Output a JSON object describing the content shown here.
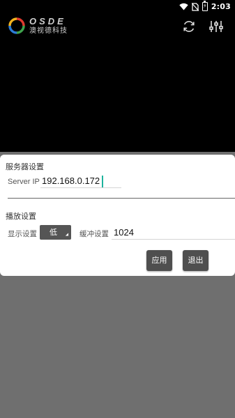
{
  "status_bar": {
    "time": "2:03",
    "icons": [
      "wifi-icon",
      "no-sim-icon",
      "battery-charging-icon"
    ]
  },
  "header": {
    "logo_brand": "OSDE",
    "logo_name": "澳视德科技",
    "logo_colors": [
      "#e03a2f",
      "#3fa34d",
      "#2b7bd6",
      "#f2b21e"
    ],
    "icons": [
      "refresh-icon",
      "tune-icon"
    ]
  },
  "dialog": {
    "server_section_title": "服务器设置",
    "server_ip_label": "Server IP",
    "server_ip_value": "192.168.0.172",
    "playback_section_title": "播放设置",
    "display_label": "显示设置",
    "display_value": "低",
    "buffer_label": "缓冲设置",
    "buffer_value": "1024",
    "apply_label": "应用",
    "exit_label": "退出"
  },
  "colors": {
    "video_background": "#000000",
    "overlay": "#6f6f6f",
    "button": "#4f4f4f",
    "caret": "#1db39d"
  }
}
